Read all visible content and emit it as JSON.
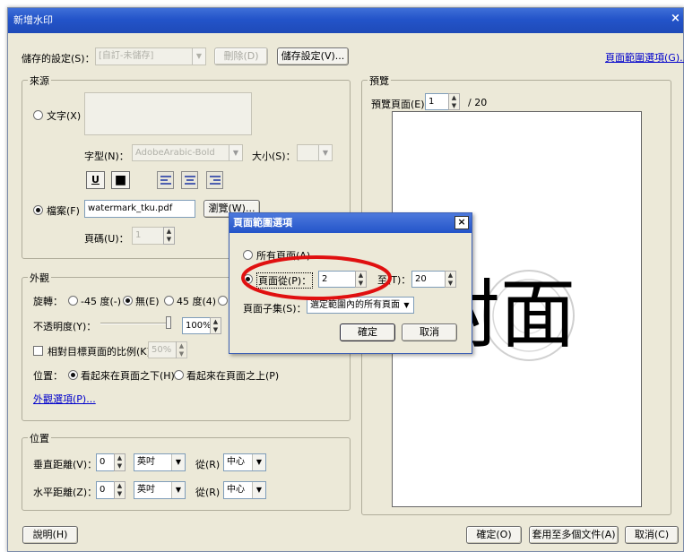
{
  "window": {
    "title": "新增水印",
    "close": "×"
  },
  "saved_settings": {
    "label": "儲存的設定(S)：",
    "value": "[自訂-未儲存]",
    "delete_label": "刪除(D)",
    "save_label": "儲存設定(V)..."
  },
  "page_range_link": "頁面範圍選項(G)...",
  "source": {
    "group_label": "來源",
    "text_radio": "文字(X)",
    "font_label": "字型(N)：",
    "font_value": "AdobeArabic-Bold",
    "size_label": "大小(S)：",
    "underline": "U",
    "color": "■",
    "file_radio": "檔案(F)",
    "file_value": "watermark_tku.pdf",
    "browse_label": "瀏覽(W)...",
    "page_label": "頁碼(U)：",
    "page_value": "1"
  },
  "appearance": {
    "group_label": "外觀",
    "rotation_label": "旋轉：",
    "rot_neg45": "-45 度(-)",
    "rot_none": "無(E)",
    "rot_45": "45 度(4)",
    "opacity_label": "不透明度(Y)：",
    "opacity_value": "100%",
    "opacity_level": 1.0,
    "scale_label": "相對目標頁面的比例(K)",
    "scale_value": "50%",
    "position_label": "位置：",
    "behind": "看起來在頁面之下(H)",
    "above": "看起來在頁面之上(P)",
    "options_link": "外觀選項(P)..."
  },
  "position": {
    "group_label": "位置",
    "vertical_label": "垂直距離(V)：",
    "vertical_value": "0",
    "horizontal_label": "水平距離(Z)：",
    "horizontal_value": "0",
    "unit": "英吋",
    "from_label": "從(R)",
    "from_value": "中心"
  },
  "preview": {
    "group_label": "預覽",
    "page_label": "預覽頁面(E)",
    "page_value": "1",
    "page_total": "/ 20",
    "watermark_text": "封面"
  },
  "page_range_dialog": {
    "title": "頁面範圍選項",
    "close": "×",
    "all_pages": "所有頁面(A)",
    "pages_from": "頁面從(P)：",
    "from_value": "2",
    "to_label": "至(T)：",
    "to_value": "20",
    "subset_label": "頁面子集(S)：",
    "subset_value": "選定範圍內的所有頁面",
    "ok": "確定",
    "cancel": "取消"
  },
  "footer": {
    "help": "說明(H)",
    "ok": "確定(O)",
    "apply_multiple": "套用至多個文件(A)",
    "cancel": "取消(C)"
  },
  "colors": {
    "highlight": "#e01010",
    "title_bar": "#2354c9",
    "link": "#0000cc"
  }
}
